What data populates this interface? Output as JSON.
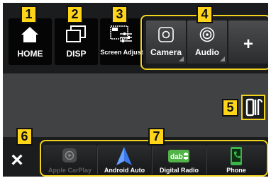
{
  "buttons": {
    "home": "HOME",
    "disp": "DISP",
    "screen_adjust": "Screen Adjust"
  },
  "shortcuts": {
    "camera": "Camera",
    "audio": "Audio",
    "add": "+"
  },
  "close": "×",
  "sources": [
    {
      "label": "Apple CarPlay",
      "icon": "carplay-icon",
      "enabled": false
    },
    {
      "label": "Android Auto",
      "icon": "android-auto-icon",
      "enabled": true
    },
    {
      "label": "Digital Radio",
      "icon": "dab-icon",
      "enabled": true
    },
    {
      "label": "Phone",
      "icon": "phone-icon",
      "enabled": true
    }
  ],
  "callouts": [
    "1",
    "2",
    "3",
    "4",
    "5",
    "6",
    "7"
  ],
  "colors": {
    "callout": "#ffd51a",
    "frame": "#f1d21f",
    "panel": "#414244",
    "band": "#1b1c1d",
    "android_auto": "#3b78e7",
    "dab": "#52b448",
    "phone": "#39b54a"
  }
}
